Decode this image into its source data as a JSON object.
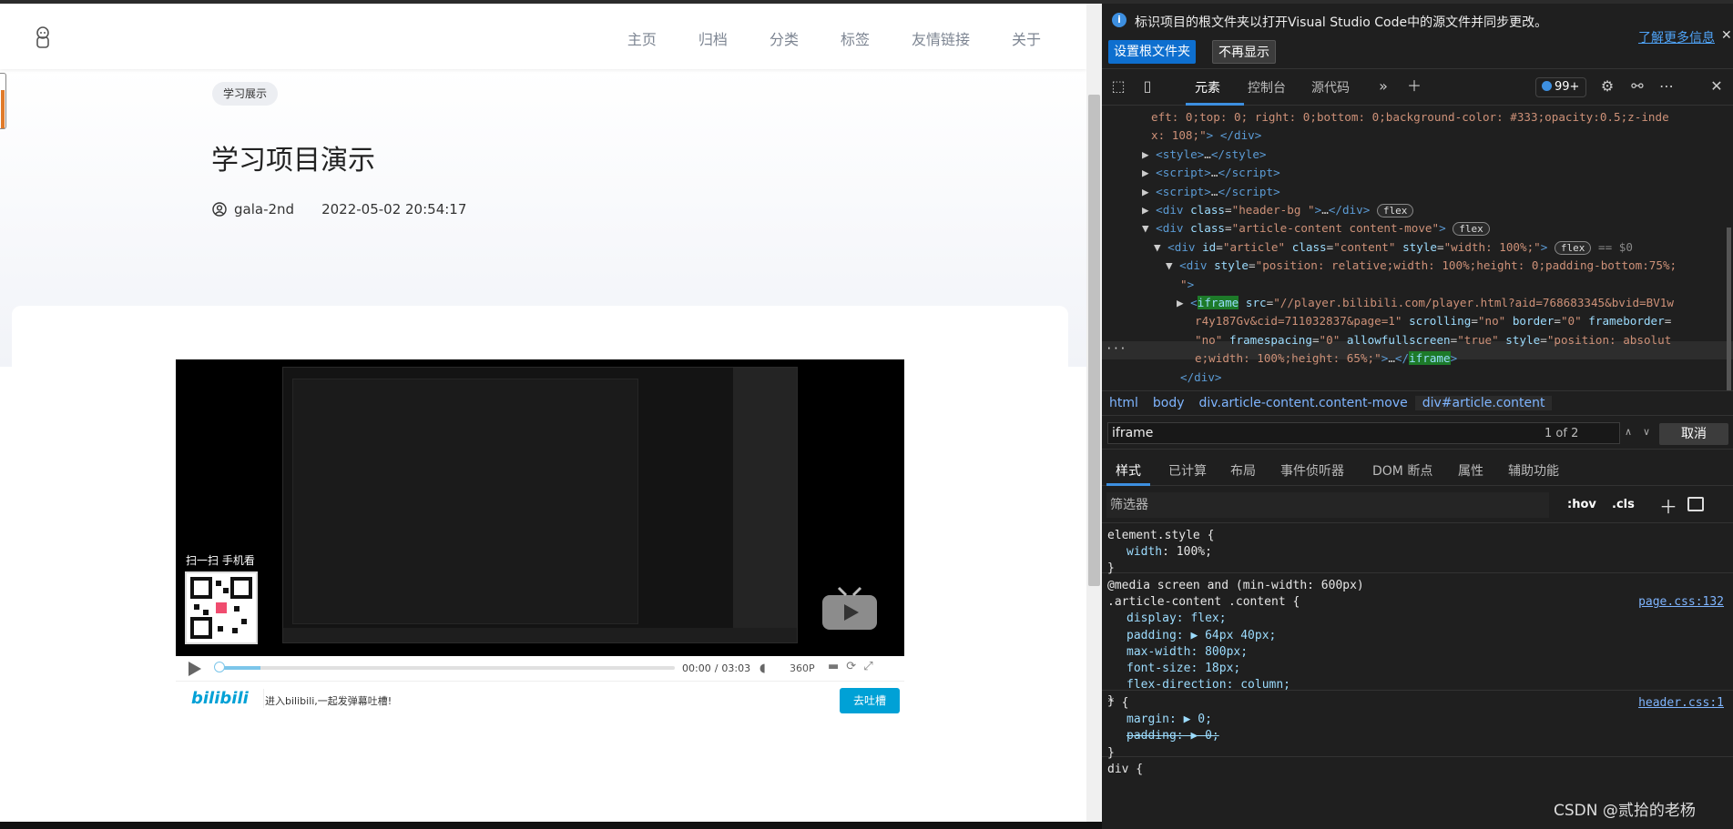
{
  "site": {
    "nav": [
      "主页",
      "归档",
      "分类",
      "标签",
      "友情链接",
      "关于"
    ],
    "tag": "学习展示",
    "title": "学习项目演示",
    "author": "gala-2nd",
    "date": "2022-05-02 20:54:17"
  },
  "video": {
    "qr_label": "扫一扫 手机看",
    "time_current": "00:00",
    "time_sep": "/",
    "time_total": "03:03",
    "quality": "360P",
    "progress_fraction": 0.09,
    "brand": "bilibili",
    "danmu_placeholder": "进入bilibili,一起发弹幕吐槽!",
    "danmu_button": "去吐槽"
  },
  "devtools": {
    "info_text": "标识项目的根文件夹以打开Visual Studio Code中的源文件并同步更改。",
    "info_learn_more": "了解更多信息",
    "btn_set_root": "设置根文件夹",
    "btn_dont_show": "不再显示",
    "tabs": [
      "元素",
      "控制台",
      "源代码"
    ],
    "issues_badge": "99+",
    "breadcrumbs": [
      "html",
      "body",
      "div.article-content.content-move",
      "div#article.content"
    ],
    "search_value": "iframe",
    "search_count": "1 of 2",
    "cancel": "取消",
    "style_tabs": [
      "样式",
      "已计算",
      "布局",
      "事件侦听器",
      "DOM 断点",
      "属性",
      "辅助功能"
    ],
    "filter_placeholder": "筛选器",
    "hov": ":hov",
    "cls": ".cls",
    "dom_dots": "···",
    "eq_marker": "== $0",
    "css_rules": {
      "r1_sel": "element.style {",
      "r1_p1_name": "width",
      "r1_p1_val": "100%;",
      "r2_media": "@media screen and (min-width: 600px)",
      "r2_sel": ".article-content .content {",
      "r2_src": "page.css:132",
      "r2_p1": "display: flex;",
      "r2_p2": "padding: ▶ 64px 40px;",
      "r2_p3": "max-width: 800px;",
      "r2_p4": "font-size: 18px;",
      "r2_p5": "flex-direction: column;",
      "r3_sel": "* {",
      "r3_src": "header.css:1",
      "r3_p1": "margin: ▶ 0;",
      "r3_p2": "padding: ▶ 0;",
      "r4_sel": "div {",
      "close": "}"
    }
  },
  "watermark": "CSDN @贰拾的老杨"
}
